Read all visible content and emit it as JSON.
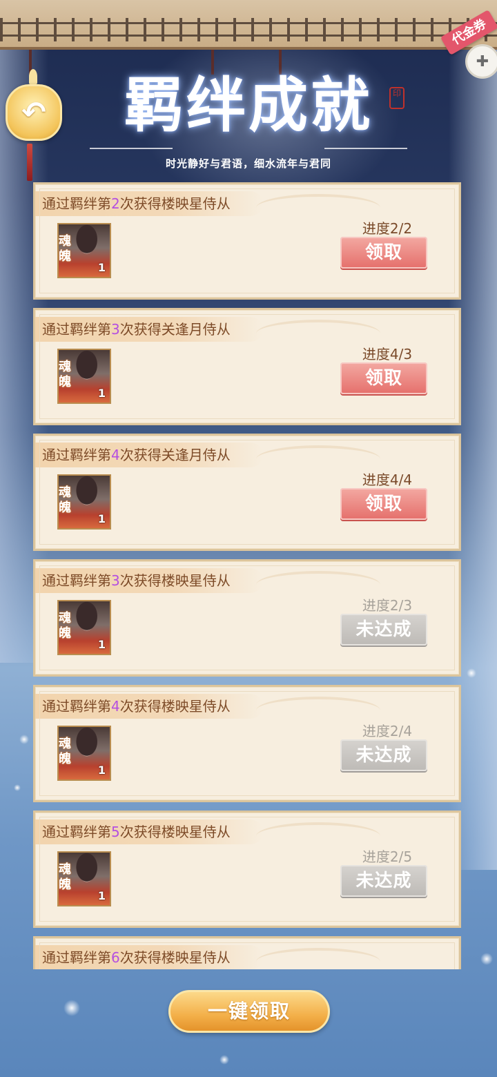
{
  "header": {
    "title": "羁绊成就",
    "subtitle": "时光静好与君语，细水流年与君同",
    "back_icon": "back-arrow-icon",
    "voucher_label": "代金券",
    "voucher_icon": "gamepad-icon"
  },
  "achievements": [
    {
      "prefix": "通过羁绊第",
      "num": "2",
      "suffix": "次获得楼映星侍从",
      "item_tag": "魂魄",
      "item_count": "1",
      "progress": "进度2/2",
      "button": "领取",
      "state": "claimable"
    },
    {
      "prefix": "通过羁绊第",
      "num": "3",
      "suffix": "次获得关逢月侍从",
      "item_tag": "魂魄",
      "item_count": "1",
      "progress": "进度4/3",
      "button": "领取",
      "state": "claimable"
    },
    {
      "prefix": "通过羁绊第",
      "num": "4",
      "suffix": "次获得关逢月侍从",
      "item_tag": "魂魄",
      "item_count": "1",
      "progress": "进度4/4",
      "button": "领取",
      "state": "claimable"
    },
    {
      "prefix": "通过羁绊第",
      "num": "3",
      "suffix": "次获得楼映星侍从",
      "item_tag": "魂魄",
      "item_count": "1",
      "progress": "进度2/3",
      "button": "未达成",
      "state": "locked"
    },
    {
      "prefix": "通过羁绊第",
      "num": "4",
      "suffix": "次获得楼映星侍从",
      "item_tag": "魂魄",
      "item_count": "1",
      "progress": "进度2/4",
      "button": "未达成",
      "state": "locked"
    },
    {
      "prefix": "通过羁绊第",
      "num": "5",
      "suffix": "次获得楼映星侍从",
      "item_tag": "魂魄",
      "item_count": "1",
      "progress": "进度2/5",
      "button": "未达成",
      "state": "locked"
    },
    {
      "prefix": "通过羁绊第",
      "num": "6",
      "suffix": "次获得楼映星侍从",
      "item_tag": "",
      "item_count": "",
      "progress": "",
      "button": "",
      "state": "partial"
    }
  ],
  "footer": {
    "claim_all_label": "一键领取"
  },
  "colors": {
    "claim_button": "#e56f6b",
    "locked_button": "#bdbab6",
    "number_highlight": "#b44fe0",
    "card_bg": "#f7eedf"
  }
}
